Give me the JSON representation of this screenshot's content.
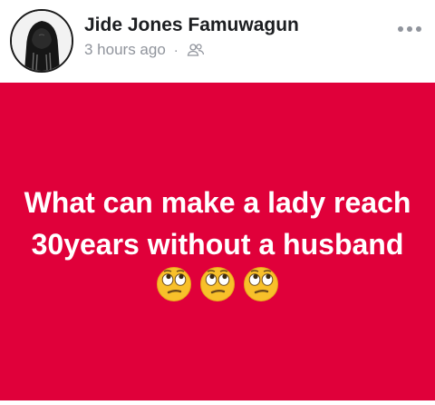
{
  "post": {
    "author": {
      "name": "Jide Jones Famuwagun"
    },
    "meta": {
      "timestamp": "3 hours ago",
      "separator": "·",
      "audience_icon": "friends-icon"
    },
    "more_icon": "more-options-icon",
    "body": {
      "background_color": "#e0003a",
      "text_color": "#ffffff",
      "lines": [
        "What can make a lady reach",
        "30years without a husband"
      ],
      "emojis": [
        "face-with-rolling-eyes",
        "face-with-rolling-eyes",
        "face-with-rolling-eyes"
      ]
    }
  }
}
